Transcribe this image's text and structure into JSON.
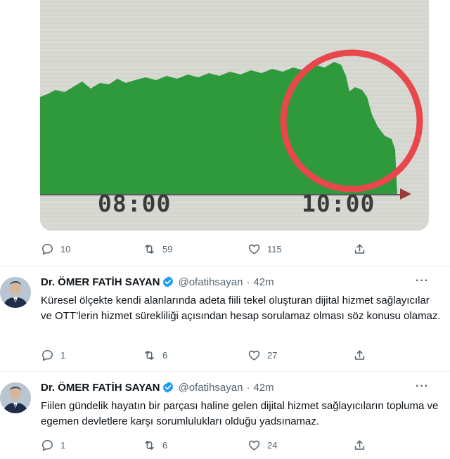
{
  "media": {
    "time_labels": [
      "08:00",
      "10:00"
    ],
    "highlight_color": "#e8474c",
    "fill_color": "#2e9a3c"
  },
  "first_tweet_actions": {
    "replies": "10",
    "retweets": "59",
    "likes": "115"
  },
  "tweets": [
    {
      "author": "Dr. ÖMER FATİH SAYAN",
      "handle": "@ofatihsayan",
      "dot": "·",
      "time": "42m",
      "text": "Küresel ölçekte kendi alanlarında adeta fiili tekel oluşturan dijital hizmet sağlayıcılar ve OTT’lerin hizmet sürekliliği açısından hesap sorulamaz olması söz konusu olamaz.",
      "replies": "1",
      "retweets": "6",
      "likes": "27"
    },
    {
      "author": "Dr. ÖMER FATİH SAYAN",
      "handle": "@ofatihsayan",
      "dot": "·",
      "time": "42m",
      "text": "Fiilen gündelik hayatın bir parçası haline gelen dijital hizmet sağlayıcıların topluma ve egemen devletlere karşı sorumlulukları olduğu yadsınamaz.",
      "replies": "1",
      "retweets": "6",
      "likes": "24"
    }
  ],
  "icons": {
    "reply": "reply-icon",
    "retweet": "retweet-icon",
    "like": "like-icon",
    "share": "share-icon",
    "verified": "verified-badge-icon",
    "more": "more-icon"
  },
  "more_glyph": "···"
}
